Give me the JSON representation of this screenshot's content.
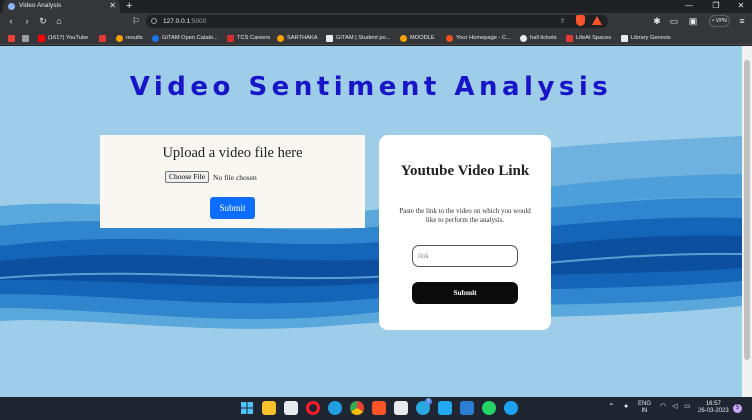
{
  "browser": {
    "tab_title": "Video Analysis",
    "tab_close": "✕",
    "new_tab": "+",
    "window_controls": [
      "—",
      "❐",
      "✕"
    ],
    "url_host": "127.0.0.1",
    "url_port": ":5000",
    "vpn_label": "• VPN",
    "nav_glyphs": {
      "back": "‹",
      "forward": "›",
      "reload": "↻",
      "home": "⌂",
      "bookmark": "⚐",
      "share": "⇪",
      "extensions": "✱",
      "sidebar": "▭",
      "wallet": "▣",
      "menu": "≡"
    }
  },
  "bookmarks": [
    {
      "label": "",
      "color": "#ea4335"
    },
    {
      "label": "",
      "color": "#9aa0a6"
    },
    {
      "label": "(1617) YouTube",
      "color": "#ff0000"
    },
    {
      "label": "",
      "color": "#e53935"
    },
    {
      "label": "results",
      "color": "#f4a300"
    },
    {
      "label": "GITAM Open Catalo...",
      "color": "#1a73e8"
    },
    {
      "label": "TCS Careers",
      "color": "#d32f2f"
    },
    {
      "label": "SARTHAKA",
      "color": "#f4a300"
    },
    {
      "label": "GITAM | Student po...",
      "color": "#e8eaed"
    },
    {
      "label": "MOODLE",
      "color": "#f4a300"
    },
    {
      "label": "Your Homepage - C...",
      "color": "#f4511e"
    },
    {
      "label": "hall tickets",
      "color": "#e8eaed"
    },
    {
      "label": "LifeAt Spaces",
      "color": "#e53935"
    },
    {
      "label": "Library Genesis",
      "color": "#e8eaed"
    }
  ],
  "page": {
    "title": "Video Sentiment Analysis",
    "upload": {
      "heading": "Upload a video file here",
      "choose_file": "Choose File",
      "no_file": "No file chosen",
      "submit": "Submit"
    },
    "youtube": {
      "heading": "Youtube Video Link",
      "description": "Paste the link to the video on which you would like to perform the analysis.",
      "input_placeholder": "link",
      "submit": "Submit"
    }
  },
  "taskbar": {
    "apps": [
      {
        "name": "windows-start",
        "color": "#4cc2ff"
      },
      {
        "name": "file-explorer",
        "color": "#f8c12c"
      },
      {
        "name": "microsoft-store",
        "color": "#e8eaed"
      },
      {
        "name": "opera",
        "color": "#ff1b2d"
      },
      {
        "name": "edge",
        "color": "#1fa0e3"
      },
      {
        "name": "chrome",
        "color": "#fbbc04"
      },
      {
        "name": "brave",
        "color": "#fb542b"
      },
      {
        "name": "notion",
        "color": "#e8eaed"
      },
      {
        "name": "telegram",
        "color": "#2aa8e0"
      },
      {
        "name": "vscode",
        "color": "#23a9f2"
      },
      {
        "name": "word",
        "color": "#2b7cd3"
      },
      {
        "name": "whatsapp",
        "color": "#25d366"
      },
      {
        "name": "app",
        "color": "#1da1f2"
      }
    ],
    "badge": "1",
    "language": "ENG",
    "region": "IN",
    "time": "16:57",
    "date": "26-03-2023",
    "notification_count": "5"
  }
}
